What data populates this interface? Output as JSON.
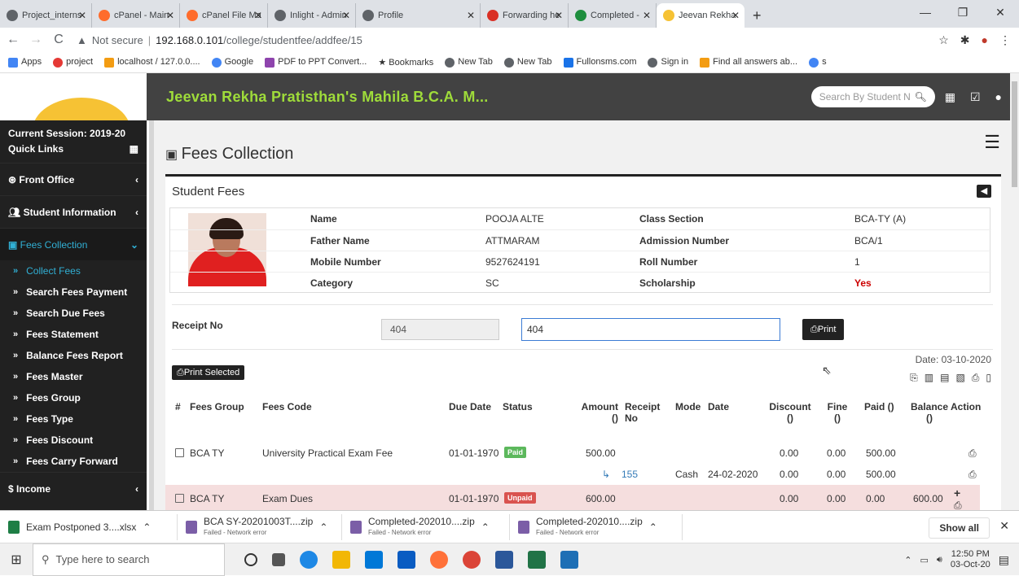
{
  "browser": {
    "tabs": [
      {
        "label": "Project_interns",
        "color": "#5f6368"
      },
      {
        "label": "cPanel - Main",
        "color": "#ff6c2c"
      },
      {
        "label": "cPanel File Ma",
        "color": "#ff6c2c"
      },
      {
        "label": "Inlight - Admin",
        "color": "#5f6368"
      },
      {
        "label": "Profile",
        "color": "#5f6368"
      },
      {
        "label": "Forwarding he",
        "color": "#d93025"
      },
      {
        "label": "Completed -",
        "color": "#1e8e3e"
      },
      {
        "label": "Jeevan Rekha",
        "color": "#f6c234"
      }
    ],
    "new_tab": "+",
    "url_warning": "Not secure",
    "url_host": "192.168.0.101",
    "url_path": "/college/studentfee/addfee/15",
    "bookmarks": [
      "Apps",
      "project",
      "localhost / 127.0.0....",
      "Google",
      "PDF to PPT Convert...",
      "Bookmarks",
      "New Tab",
      "New Tab",
      "Fullonsms.com",
      "Sign in",
      "Find all answers ab...",
      "s"
    ]
  },
  "header": {
    "site_title": "Jeevan Rekha Pratisthan's Mahila B.C.A. M...",
    "search_placeholder": "Search By Student Name"
  },
  "sidebar": {
    "session": "Current Session: 2019-20",
    "quick_links": "Quick Links",
    "items": [
      {
        "label": "Front Office"
      },
      {
        "label": "Student Information"
      },
      {
        "label": "Fees Collection"
      }
    ],
    "sub_items": [
      "Collect Fees",
      "Search Fees Payment",
      "Search Due Fees",
      "Fees Statement",
      "Balance Fees Report",
      "Fees Master",
      "Fees Group",
      "Fees Type",
      "Fees Discount",
      "Fees Carry Forward"
    ],
    "income": "Income"
  },
  "main": {
    "page_title": "Fees Collection",
    "box_title": "Student Fees",
    "student": {
      "name_label": "Name",
      "name": "POOJA ALTE",
      "father_label": "Father Name",
      "father": "ATTMARAM",
      "mobile_label": "Mobile Number",
      "mobile": "9527624191",
      "category_label": "Category",
      "category": "SC",
      "class_label": "Class Section",
      "class": "BCA-TY (A)",
      "admission_label": "Admission Number",
      "admission": "BCA/1",
      "roll_label": "Roll Number",
      "roll": "1",
      "scholarship_label": "Scholarship",
      "scholarship": "Yes"
    },
    "receipt_label": "Receipt No",
    "receipt_value1": "404",
    "receipt_value2": "404",
    "print_label": "Print",
    "print_selected": "Print Selected",
    "date": "Date: 03-10-2020",
    "table": {
      "headers": {
        "num": "#",
        "group": "Fees Group",
        "code": "Fees Code",
        "due": "Due Date",
        "status": "Status",
        "amount": "Amount ()",
        "receipt": "Receipt No",
        "mode": "Mode",
        "date": "Date",
        "discount": "Discount ()",
        "fine": "Fine ()",
        "paid": "Paid ()",
        "balance": "Balance ()",
        "action": "Action"
      },
      "rows": [
        {
          "group": "BCA TY",
          "code": "University Practical Exam Fee",
          "due": "01-01-1970",
          "status": "Paid",
          "amount": "500.00",
          "discount": "0.00",
          "fine": "0.00",
          "paid": "500.00",
          "balance": ""
        },
        {
          "receipt": "155",
          "mode": "Cash",
          "date": "24-02-2020",
          "discount": "0.00",
          "fine": "0.00",
          "paid": "500.00"
        },
        {
          "group": "BCA TY",
          "code": "Exam Dues",
          "due": "01-01-1970",
          "status": "Unpaid",
          "amount": "600.00",
          "discount": "0.00",
          "fine": "0.00",
          "paid": "0.00",
          "balance": "600.00"
        }
      ]
    }
  },
  "downloads": [
    {
      "name": "Exam Postponed 3....xlsx",
      "status": ""
    },
    {
      "name": "BCA SY-20201003T....zip",
      "status": "Failed - Network error"
    },
    {
      "name": "Completed-202010....zip",
      "status": "Failed - Network error"
    },
    {
      "name": "Completed-202010....zip",
      "status": "Failed - Network error"
    }
  ],
  "show_all": "Show all",
  "taskbar": {
    "search_placeholder": "Type here to search",
    "time": "12:50 PM",
    "date": "03-Oct-20"
  }
}
